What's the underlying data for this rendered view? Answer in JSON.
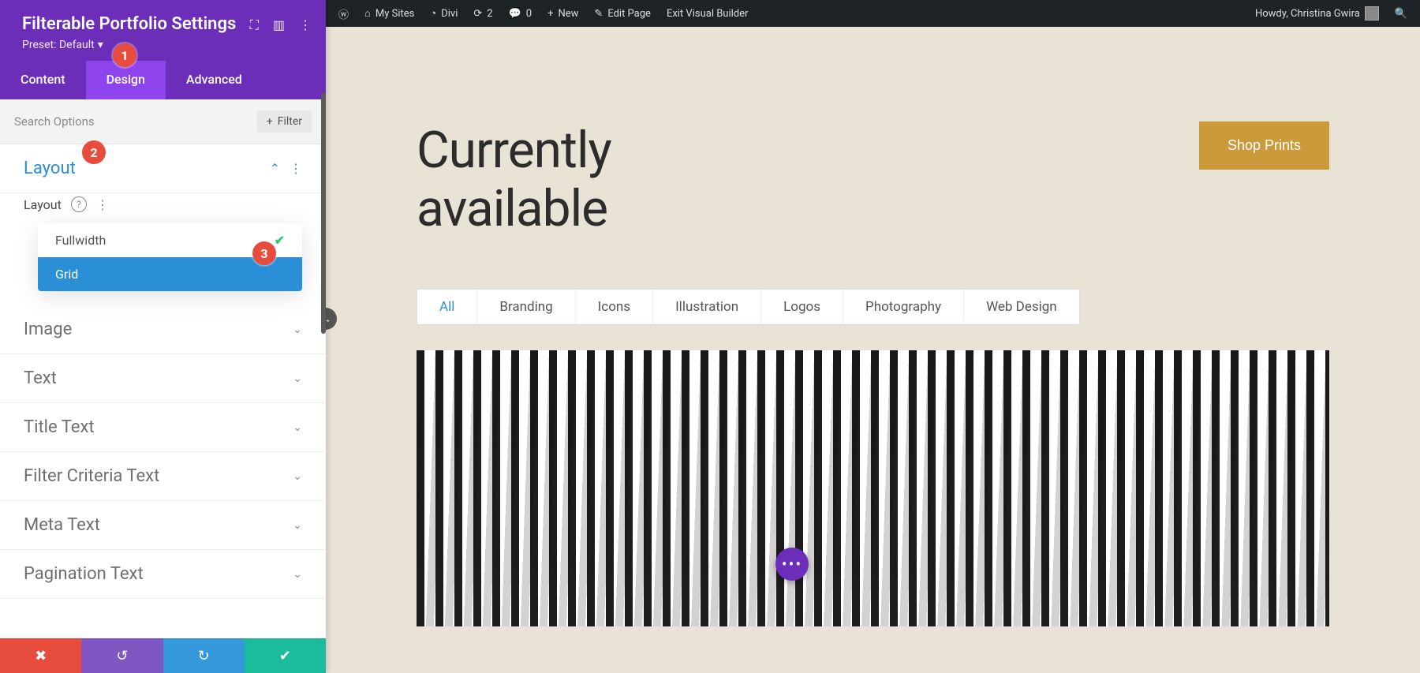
{
  "wp_bar": {
    "my_sites": "My Sites",
    "site_name": "Divi",
    "updates": "2",
    "comments": "0",
    "new": "New",
    "edit_page": "Edit Page",
    "exit_builder": "Exit Visual Builder",
    "howdy": "Howdy, Christina Gwira"
  },
  "panel": {
    "title": "Filterable Portfolio Settings",
    "preset": "Preset: Default",
    "tabs": {
      "content": "Content",
      "design": "Design",
      "advanced": "Advanced"
    },
    "search_placeholder": "Search Options",
    "filter_label": "Filter"
  },
  "sections": {
    "layout": "Layout",
    "image": "Image",
    "text": "Text",
    "title_text": "Title Text",
    "filter_criteria": "Filter Criteria Text",
    "meta_text": "Meta Text",
    "pagination_text": "Pagination Text"
  },
  "layout_field": {
    "label": "Layout",
    "option_fullwidth": "Fullwidth",
    "option_grid": "Grid"
  },
  "preview": {
    "heading_l1": "Currently",
    "heading_l2": "available",
    "shop_button": "Shop Prints",
    "filters": {
      "all": "All",
      "branding": "Branding",
      "icons": "Icons",
      "illustration": "Illustration",
      "logos": "Logos",
      "photography": "Photography",
      "web_design": "Web Design"
    }
  },
  "badges": {
    "b1": "1",
    "b2": "2",
    "b3": "3"
  }
}
